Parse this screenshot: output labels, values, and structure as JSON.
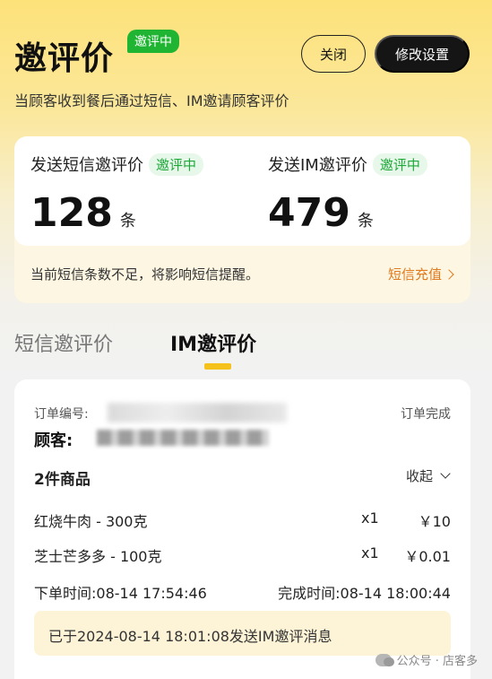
{
  "header": {
    "title": "邀评价",
    "title_badge": "邀评中",
    "close_label": "关闭",
    "settings_label": "修改设置",
    "subtitle": "当顾客收到餐后通过短信、IM邀请顾客评价"
  },
  "stats": {
    "sms": {
      "label": "发送短信邀评价",
      "badge": "邀评中",
      "count": "128",
      "unit": "条"
    },
    "im": {
      "label": "发送IM邀评价",
      "badge": "邀评中",
      "count": "479",
      "unit": "条"
    },
    "notice": "当前短信条数不足，将影响短信提醒。",
    "recharge_label": "短信充值"
  },
  "tabs": [
    {
      "label": "短信邀评价",
      "active": false
    },
    {
      "label": "IM邀评价",
      "active": true
    }
  ],
  "order": {
    "order_no_label": "订单编号:",
    "status": "订单完成",
    "customer_label": "顾客:",
    "items_title": "2件商品",
    "collapse_label": "收起",
    "items": [
      {
        "name": "红烧牛肉 - 300克",
        "qty": "x1",
        "price": "￥10"
      },
      {
        "name": "芝士芒多多 - 100克",
        "qty": "x1",
        "price": "￥0.01"
      }
    ],
    "order_time": "下单时间:08-14 17:54:46",
    "complete_time": "完成时间:08-14 18:00:44",
    "im_sent_message": "已于2024-08-14 18:01:08发送IM邀评消息"
  },
  "watermark": "公众号 · 店客多",
  "colors": {
    "accent_yellow": "#f5c21b",
    "badge_green": "#1fb532",
    "recharge_orange": "#e07a1e"
  }
}
